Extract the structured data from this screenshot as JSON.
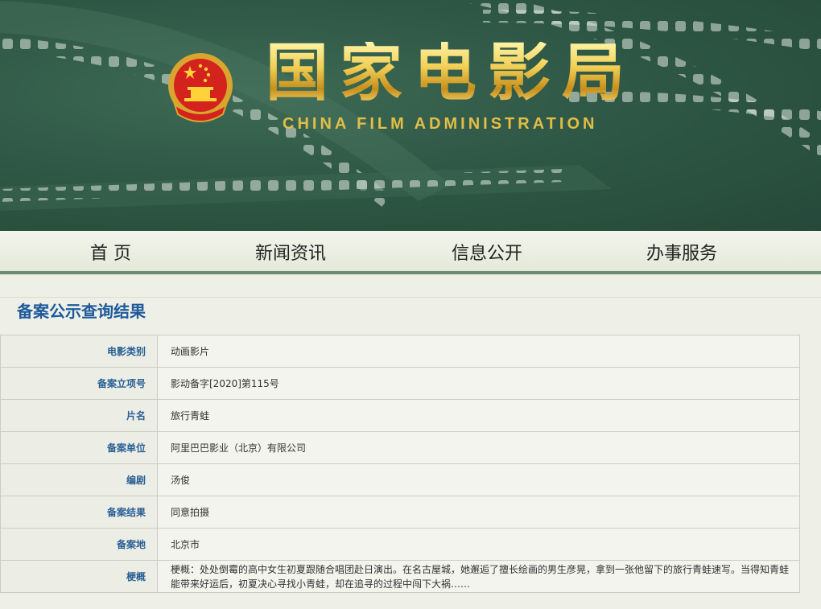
{
  "header": {
    "title_cn": "国家电影局",
    "title_en": "CHINA FILM ADMINISTRATION"
  },
  "nav": {
    "items": [
      {
        "label": "首 页"
      },
      {
        "label": "新闻资讯"
      },
      {
        "label": "信息公开"
      },
      {
        "label": "办事服务"
      }
    ]
  },
  "main": {
    "section_title": "备案公示查询结果",
    "rows": [
      {
        "label": "电影类别",
        "value": "动画影片"
      },
      {
        "label": "备案立项号",
        "value": "影动备字[2020]第115号"
      },
      {
        "label": "片名",
        "value": "旅行青蛙"
      },
      {
        "label": "备案单位",
        "value": "阿里巴巴影业（北京）有限公司"
      },
      {
        "label": "编剧",
        "value": "汤俊"
      },
      {
        "label": "备案结果",
        "value": "同意拍摄"
      },
      {
        "label": "备案地",
        "value": "北京市"
      },
      {
        "label": "梗概",
        "value": "梗概：处处倒霉的高中女生初夏跟随合唱团赴日演出。在名古屋城，她邂逅了擅长绘画的男生彦晃，拿到一张他留下的旅行青蛙速写。当得知青蛙能带来好运后，初夏决心寻找小青蛙，却在追寻的过程中闯下大祸……"
      }
    ]
  },
  "colors": {
    "banner_green": "#2f5846",
    "gold": "#e2be46",
    "label_blue": "#2a5f94",
    "title_blue": "#1e5a9a"
  }
}
